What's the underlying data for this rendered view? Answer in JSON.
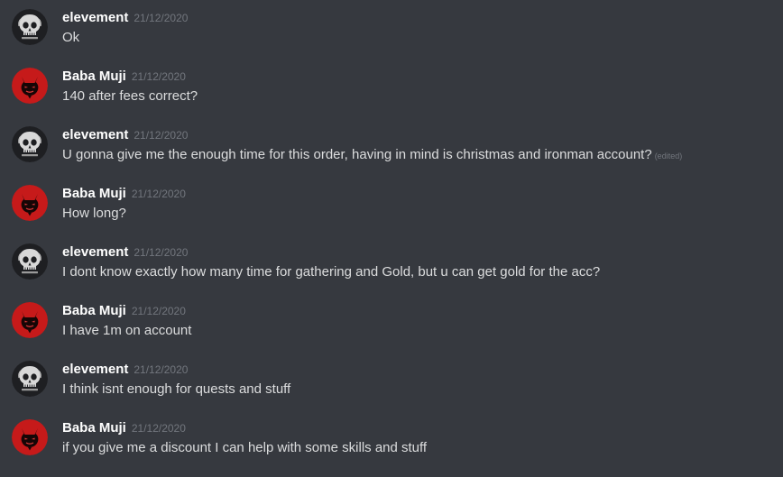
{
  "colors": {
    "background": "#36393f",
    "username": "#ffffff",
    "timestamp": "#72767d",
    "message_text": "#dcddde",
    "avatar_red": "#c61a1a"
  },
  "avatars": {
    "elevement": "skull-icon",
    "baba_muji": "devil-icon"
  },
  "messages": [
    {
      "author": "elevement",
      "avatar": "elevement",
      "timestamp": "21/12/2020",
      "text": "Ok"
    },
    {
      "author": "Baba Muji",
      "avatar": "baba_muji",
      "timestamp": "21/12/2020",
      "text": "140 after fees correct?"
    },
    {
      "author": "elevement",
      "avatar": "elevement",
      "timestamp": "21/12/2020",
      "text": "U gonna give me the enough time for this order, having in mind is christmas and ironman account?",
      "edited_label": "(edited)"
    },
    {
      "author": "Baba Muji",
      "avatar": "baba_muji",
      "timestamp": "21/12/2020",
      "text": "How long?"
    },
    {
      "author": "elevement",
      "avatar": "elevement",
      "timestamp": "21/12/2020",
      "text": "I dont know exactly how many time for gathering and Gold, but u can get gold for the acc?"
    },
    {
      "author": "Baba Muji",
      "avatar": "baba_muji",
      "timestamp": "21/12/2020",
      "text": "I have 1m on account"
    },
    {
      "author": "elevement",
      "avatar": "elevement",
      "timestamp": "21/12/2020",
      "text": "I think isnt enough for quests and stuff"
    },
    {
      "author": "Baba Muji",
      "avatar": "baba_muji",
      "timestamp": "21/12/2020",
      "text": "if you give me a discount I can help with some skills and stuff"
    }
  ]
}
